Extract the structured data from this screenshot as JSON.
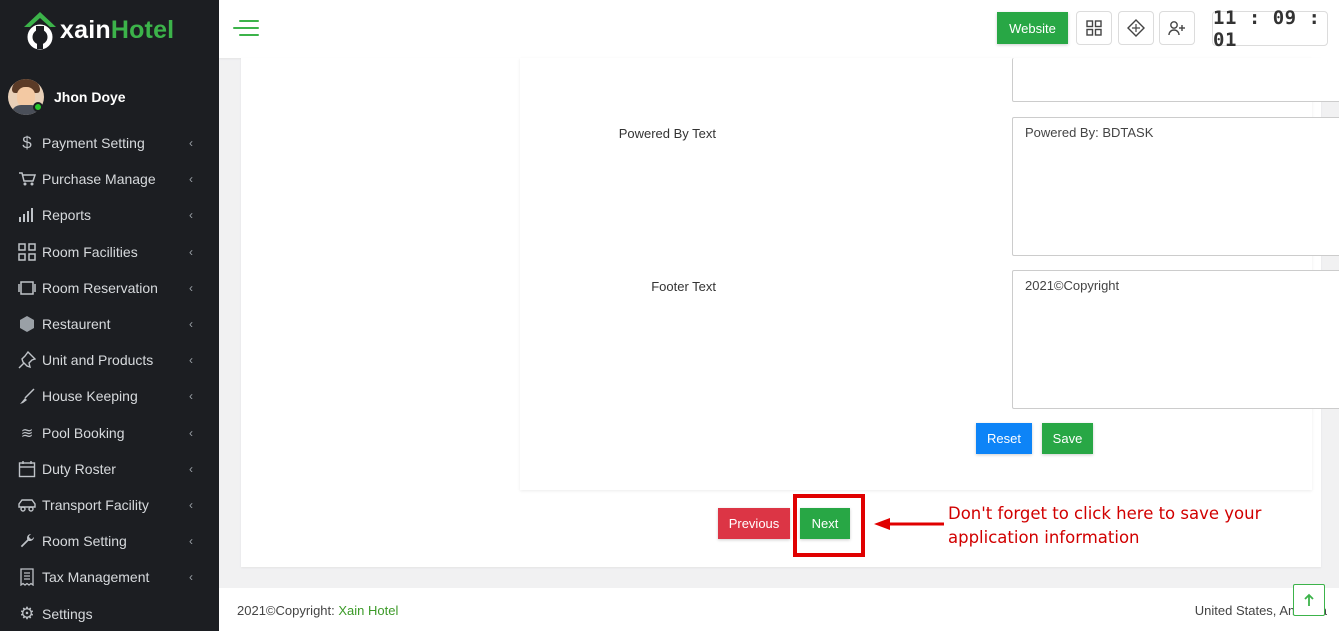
{
  "brand": {
    "prefix": "xain",
    "suffix": "Hotel",
    "green": "#3cb34a"
  },
  "user": {
    "name": "Jhon Doye",
    "status": "online"
  },
  "sidebar": {
    "items": [
      {
        "label": "Payment Setting",
        "icon": "dollar-icon"
      },
      {
        "label": "Purchase Manage",
        "icon": "cart-icon"
      },
      {
        "label": "Reports",
        "icon": "bar-chart-icon"
      },
      {
        "label": "Room Facilities",
        "icon": "grid-icon"
      },
      {
        "label": "Room Reservation",
        "icon": "reservation-icon"
      },
      {
        "label": "Restaurent",
        "icon": "hexagon-icon"
      },
      {
        "label": "Unit and Products",
        "icon": "pin-icon"
      },
      {
        "label": "House Keeping",
        "icon": "broom-icon"
      },
      {
        "label": "Pool Booking",
        "icon": "waves-icon"
      },
      {
        "label": "Duty Roster",
        "icon": "calendar-icon"
      },
      {
        "label": "Transport Facility",
        "icon": "car-icon"
      },
      {
        "label": "Room Setting",
        "icon": "wrench-icon"
      },
      {
        "label": "Tax Management",
        "icon": "receipt-icon"
      },
      {
        "label": "Settings",
        "icon": "gear-icon"
      }
    ]
  },
  "header": {
    "website_label": "Website",
    "clock": "11 : 09 : 01"
  },
  "form": {
    "powered_by": {
      "label": "Powered By Text",
      "value": "Powered By: BDTASK"
    },
    "footer_text": {
      "label": "Footer Text",
      "value": "2021©Copyright"
    },
    "reset_label": "Reset",
    "save_label": "Save"
  },
  "wizard": {
    "previous_label": "Previous",
    "next_label": "Next"
  },
  "annotation": {
    "note": "Don't forget to click here to save your application information",
    "color": "#d10000"
  },
  "footer": {
    "copyright_prefix": "2021©Copyright: ",
    "company": "Xain Hotel",
    "location": "United States, America"
  }
}
